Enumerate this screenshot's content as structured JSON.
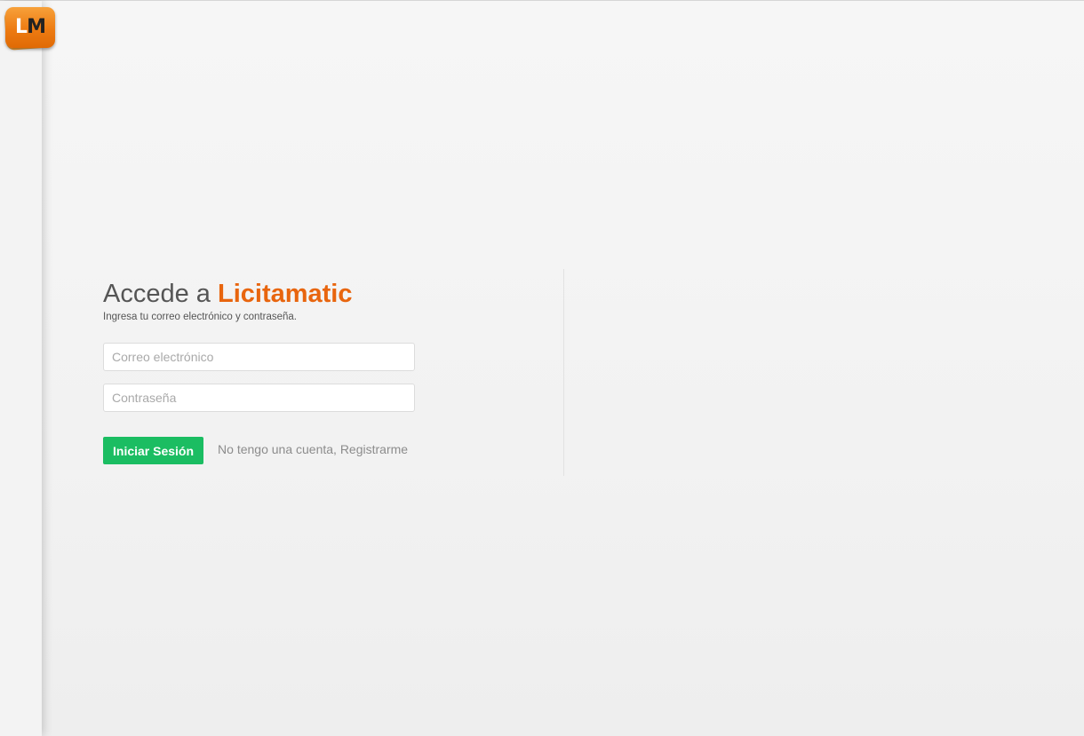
{
  "logo": {
    "letter_l": "L",
    "letter_m": "M",
    "colors": {
      "primary": "#ed7b12",
      "l": "#ffffff",
      "m": "#222222"
    }
  },
  "login": {
    "title_prefix": "Accede a",
    "brand_name": "Licitamatic",
    "subtitle": "Ingresa tu correo electrónico y contraseña.",
    "email": {
      "value": "",
      "placeholder": "Correo electrónico"
    },
    "password": {
      "value": "",
      "placeholder": "Contraseña"
    },
    "submit_label": "Iniciar Sesión",
    "register_link": "No tengo una cuenta, Registrarme"
  },
  "colors": {
    "brand": "#e8650e",
    "button": "#1bbd62",
    "text": "#555555",
    "muted": "#8c8c8c",
    "background": "#f1f1f1"
  }
}
